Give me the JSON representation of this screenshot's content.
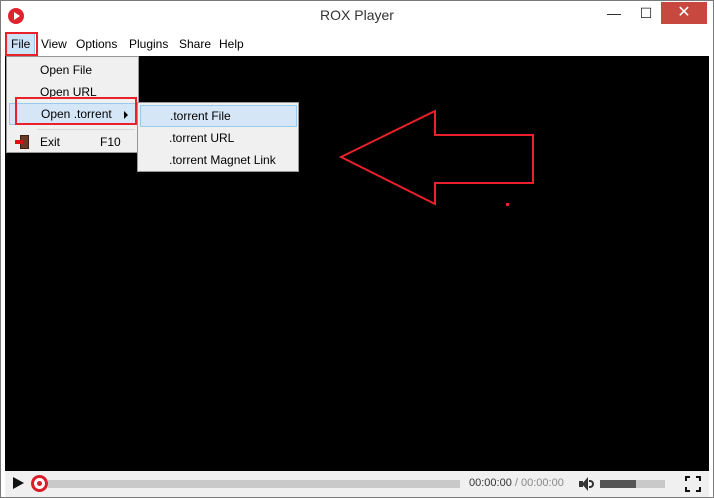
{
  "window": {
    "title": "ROX Player",
    "minimize_glyph": "—",
    "maximize_glyph": "☐",
    "close_glyph": "✕",
    "icon": "rox-player-app-icon"
  },
  "menubar": {
    "items": [
      {
        "label": "File"
      },
      {
        "label": "View"
      },
      {
        "label": "Options"
      },
      {
        "label": "Plugins"
      },
      {
        "label": "Share"
      },
      {
        "label": "Help"
      }
    ]
  },
  "file_menu": {
    "items": [
      {
        "label": "Open File"
      },
      {
        "label": "Open URL"
      },
      {
        "label": "Open .torrent",
        "has_submenu": true
      },
      {
        "label": "Exit",
        "shortcut": "F10",
        "icon": "exit-door-icon"
      }
    ]
  },
  "torrent_submenu": {
    "items": [
      {
        "label": ".torrent File"
      },
      {
        "label": ".torrent URL"
      },
      {
        "label": ".torrent Magnet Link"
      }
    ]
  },
  "controls": {
    "current_time": "00:00:00",
    "separator": " / ",
    "total_time": "00:00:00",
    "seek_progress": 0,
    "volume_level": 0.55
  },
  "colors": {
    "accent": "#e0242f",
    "annotation": "#e8212b",
    "menu_highlight": "#d5e6f7",
    "video_bg": "#000000"
  }
}
